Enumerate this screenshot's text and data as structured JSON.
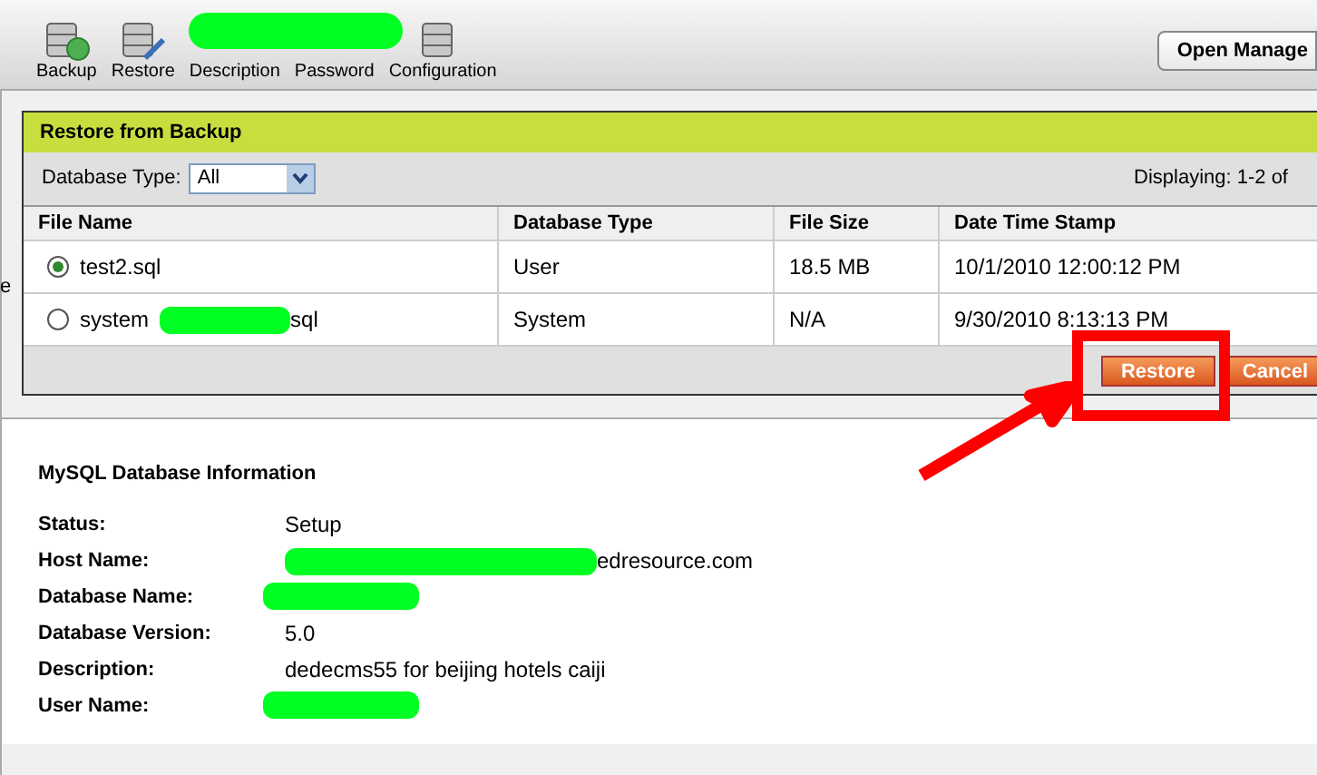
{
  "toolbar": {
    "items": [
      {
        "label": "Backup"
      },
      {
        "label": "Restore"
      },
      {
        "label": "Description"
      },
      {
        "label": "Password"
      },
      {
        "label": "Configuration"
      }
    ],
    "right_button": "Open Manage"
  },
  "sidebar_text": "e",
  "panel": {
    "title": "Restore from Backup",
    "filter_label": "Database Type:",
    "filter_value": "All",
    "displaying": "Displaying: 1-2 of",
    "columns": [
      "File Name",
      "Database Type",
      "File Size",
      "Date Time Stamp"
    ],
    "rows": [
      {
        "selected": true,
        "file_name_parts": [
          "test2.sql"
        ],
        "db_type": "User",
        "size": "18.5 MB",
        "date": "10/1/2010 12:00:12 PM"
      },
      {
        "selected": false,
        "file_name_parts": [
          "system",
          "sql"
        ],
        "db_type": "System",
        "size": "N/A",
        "date": "9/30/2010 8:13:13 PM"
      }
    ],
    "buttons": [
      "Restore",
      "Cancel"
    ]
  },
  "info": {
    "title": "MySQL Database Information",
    "fields": [
      {
        "label": "Status:",
        "kind": "text",
        "value": "Setup"
      },
      {
        "label": "Host Name:",
        "kind": "masked_prefix",
        "value": "edresource.com"
      },
      {
        "label": "Database Name:",
        "kind": "masked"
      },
      {
        "label": "Database Version:",
        "kind": "text",
        "value": "5.0"
      },
      {
        "label": "Description:",
        "kind": "text",
        "value": "dedecms55 for beijing hotels caiji"
      },
      {
        "label": "User Name:",
        "kind": "masked"
      }
    ]
  }
}
